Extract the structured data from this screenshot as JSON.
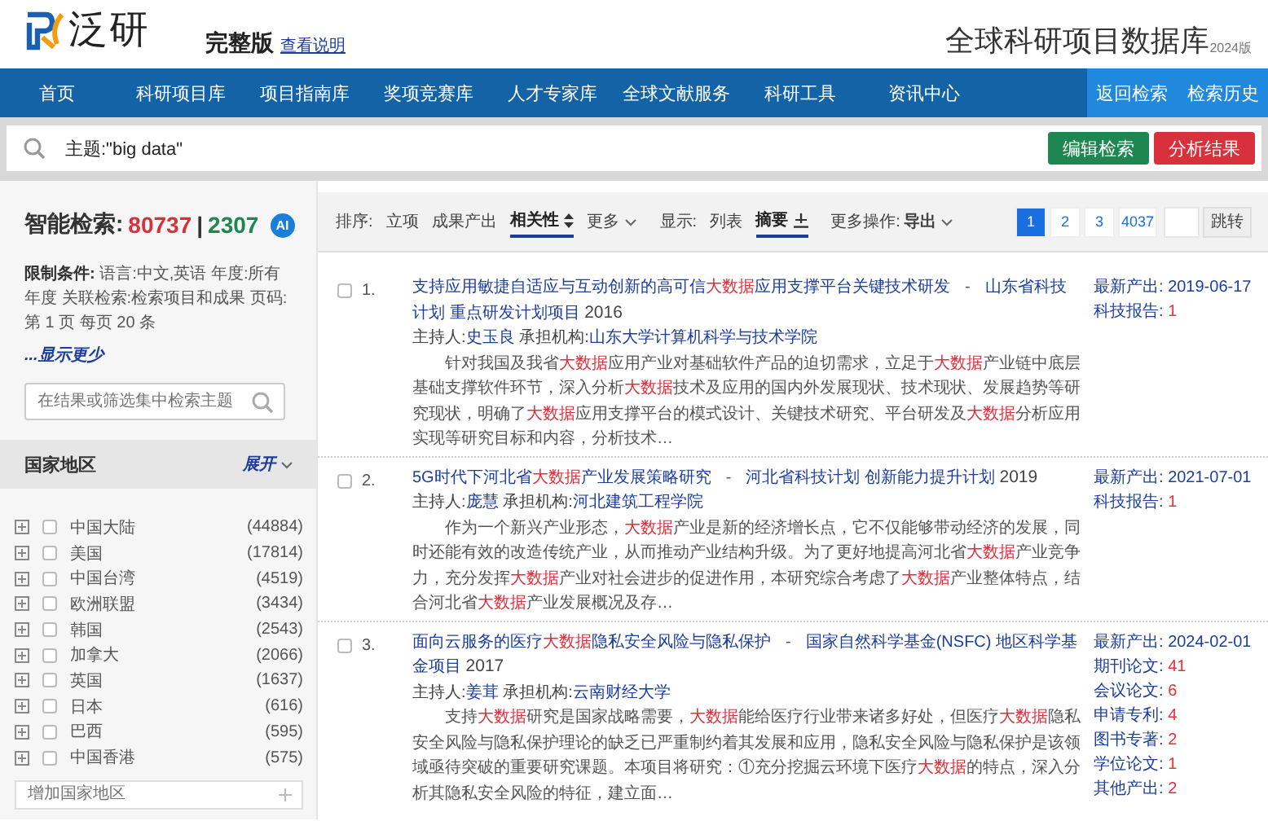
{
  "header": {
    "logo_text": "泛研",
    "edition": "完整版",
    "help_link": "查看说明",
    "site_title": "全球科研项目数据库",
    "version": "2024版"
  },
  "nav": {
    "items": [
      "首页",
      "科研项目库",
      "项目指南库",
      "奖项竞赛库",
      "人才专家库",
      "全球文献服务",
      "科研工具",
      "资讯中心"
    ],
    "right_links": [
      "返回检索",
      "检索历史"
    ]
  },
  "search": {
    "query": "主题:\"big data\"",
    "buttons": [
      {
        "label": "编辑检索",
        "kind": "edit"
      },
      {
        "label": "分析结果",
        "kind": "analyze"
      }
    ]
  },
  "sidebar": {
    "title": "智能检索:",
    "total": "80737",
    "separator": "|",
    "count": "2307",
    "ai_badge": "AI",
    "limits": "**限制条件:** 语言:中文,英语 年度:所有年度 关联检索:检索项目和成果 页码:第 1 页 每页 20 条",
    "show_less": "...显示更少",
    "filter_placeholder": "在结果或筛选集中检索主题",
    "facet": {
      "title": "国家地区",
      "toggle": "展开",
      "items": [
        {
          "name": "中国大陆",
          "count": "(44884)",
          "checked": false
        },
        {
          "name": "美国",
          "count": "(17814)",
          "checked": false
        },
        {
          "name": "中国台湾",
          "count": "(4519)",
          "checked": false
        },
        {
          "name": "欧洲联盟",
          "count": "(3434)",
          "checked": false
        },
        {
          "name": "韩国",
          "count": "(2543)",
          "checked": false
        },
        {
          "name": "加拿大",
          "count": "(2066)",
          "checked": false
        },
        {
          "name": "英国",
          "count": "(1637)",
          "checked": false
        },
        {
          "name": "日本",
          "count": "(616)",
          "checked": false
        },
        {
          "name": "巴西",
          "count": "(595)",
          "checked": false
        },
        {
          "name": "中国香港",
          "count": "(575)",
          "checked": false
        }
      ],
      "add_placeholder": "增加国家地区"
    }
  },
  "toolbar": {
    "sort_label": "排序:",
    "sort_options": [
      {
        "label": "立项",
        "selected": false
      },
      {
        "label": "成果产出",
        "selected": false
      },
      {
        "label": "相关性",
        "selected": true
      }
    ],
    "more": "更多",
    "display_label": "显示:",
    "display_options": [
      {
        "label": "列表",
        "selected": false
      },
      {
        "label": "摘要",
        "selected": true
      }
    ],
    "actions_label": "更多操作:",
    "export": "导出",
    "pages": [
      {
        "label": "1",
        "selected": true
      },
      {
        "label": "2",
        "selected": false
      },
      {
        "label": "3",
        "selected": false
      },
      {
        "label": "4037",
        "selected": false
      }
    ],
    "jump": "跳转"
  },
  "results": [
    {
      "index": "1.",
      "checked": false,
      "title": "支持应用敏捷自适应与互动创新的高可信**大数据**应用支撑平台关键技术研发",
      "separator": "-",
      "program": "山东省科技计划 重点研发计划项目",
      "year": "2016",
      "host_label": "主持人:",
      "host": "史玉良",
      "org_label": "承担机构:",
      "org": "山东大学计算机科学与技术学院",
      "abstract": "针对我国及我省**大数据**应用产业对基础软件产品的迫切需求，立足于**大数据**产业链中底层基础支撑软件环节，深入分析**大数据**技术及应用的国内外发展现状、技术现状、发展趋势等研究现状，明确了**大数据**应用支撑平台的模式设计、关键技术研究、平台研发及**大数据**分析应用实现等研究目标和内容，分析技术…",
      "stats": [
        {
          "label": "最新产出:",
          "value": "2019-06-17",
          "kind": "date"
        },
        {
          "label": "科技报告:",
          "value": "1",
          "kind": "count"
        }
      ]
    },
    {
      "index": "2.",
      "checked": false,
      "title": "5G时代下河北省**大数据**产业发展策略研究",
      "separator": "-",
      "program": "河北省科技计划 创新能力提升计划",
      "year": "2019",
      "host_label": "主持人:",
      "host": "庞慧",
      "org_label": "承担机构:",
      "org": "河北建筑工程学院",
      "abstract": "作为一个新兴产业形态，**大数据**产业是新的经济增长点，它不仅能够带动经济的发展，同时还能有效的改造传统产业，从而推动产业结构升级。为了更好地提高河北省**大数据**产业竞争力，充分发挥**大数据**产业对社会进步的促进作用，本研究综合考虑了**大数据**产业整体特点，结合河北省**大数据**产业发展概况及存…",
      "stats": [
        {
          "label": "最新产出:",
          "value": "2021-07-01",
          "kind": "date"
        },
        {
          "label": "科技报告:",
          "value": "1",
          "kind": "count"
        }
      ]
    },
    {
      "index": "3.",
      "checked": false,
      "title": "面向云服务的医疗**大数据**隐私安全风险与隐私保护",
      "separator": "-",
      "program": "国家自然科学基金(NSFC) 地区科学基金项目",
      "year": "2017",
      "host_label": "主持人:",
      "host": "姜茸",
      "org_label": "承担机构:",
      "org": "云南财经大学",
      "abstract": "支持**大数据**研究是国家战略需要，**大数据**能给医疗行业带来诸多好处，但医疗**大数据**隐私安全风险与隐私保护理论的缺乏已严重制约着其发展和应用，隐私安全风险与隐私保护是该领域亟待突破的重要研究课题。本项目将研究：①充分挖掘云环境下医疗**大数据**的特点，深入分析其隐私安全风险的特征，建立面…",
      "stats": [
        {
          "label": "最新产出:",
          "value": "2024-02-01",
          "kind": "date"
        },
        {
          "label": "期刊论文:",
          "value": "41",
          "kind": "count"
        },
        {
          "label": "会议论文:",
          "value": "6",
          "kind": "count"
        },
        {
          "label": "申请专利:",
          "value": "4",
          "kind": "count"
        },
        {
          "label": "图书专著:",
          "value": "2",
          "kind": "count"
        },
        {
          "label": "学位论文:",
          "value": "1",
          "kind": "count"
        },
        {
          "label": "其他产出:",
          "value": "2",
          "kind": "count"
        }
      ]
    }
  ]
}
